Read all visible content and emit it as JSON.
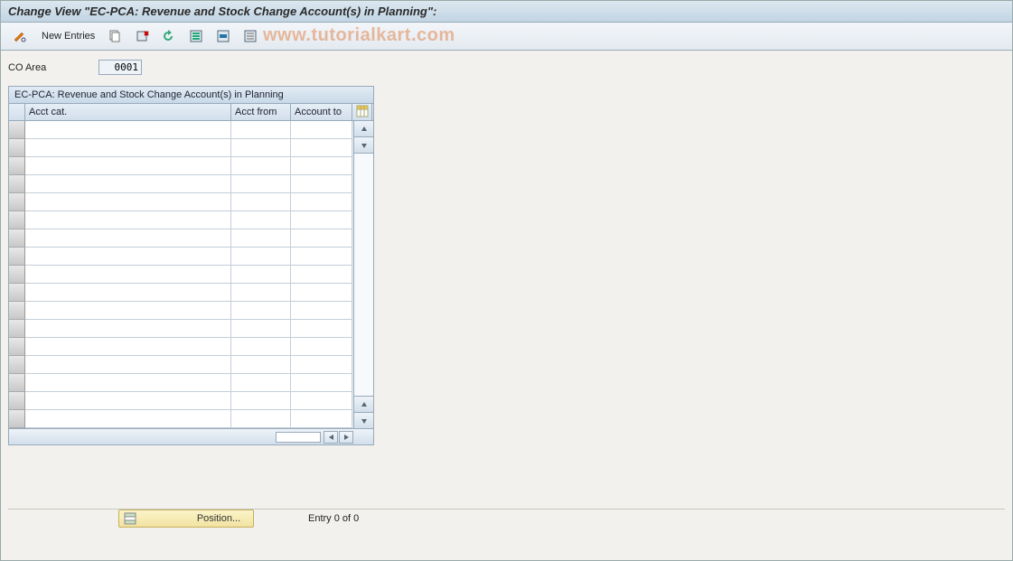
{
  "title": "Change View \"EC-PCA: Revenue and Stock Change Account(s) in Planning\":",
  "toolbar": {
    "new_entries_label": "New Entries"
  },
  "watermark": "www.tutorialkart.com",
  "co_area": {
    "label": "CO Area",
    "value": "0001"
  },
  "grid": {
    "title": "EC-PCA: Revenue and Stock Change Account(s) in Planning",
    "columns": {
      "acct_cat": "Acct cat.",
      "acct_from": "Acct from",
      "account_to": "Account to"
    },
    "row_count": 17
  },
  "footer": {
    "position_button": "Position...",
    "entry_status": "Entry 0 of 0"
  }
}
